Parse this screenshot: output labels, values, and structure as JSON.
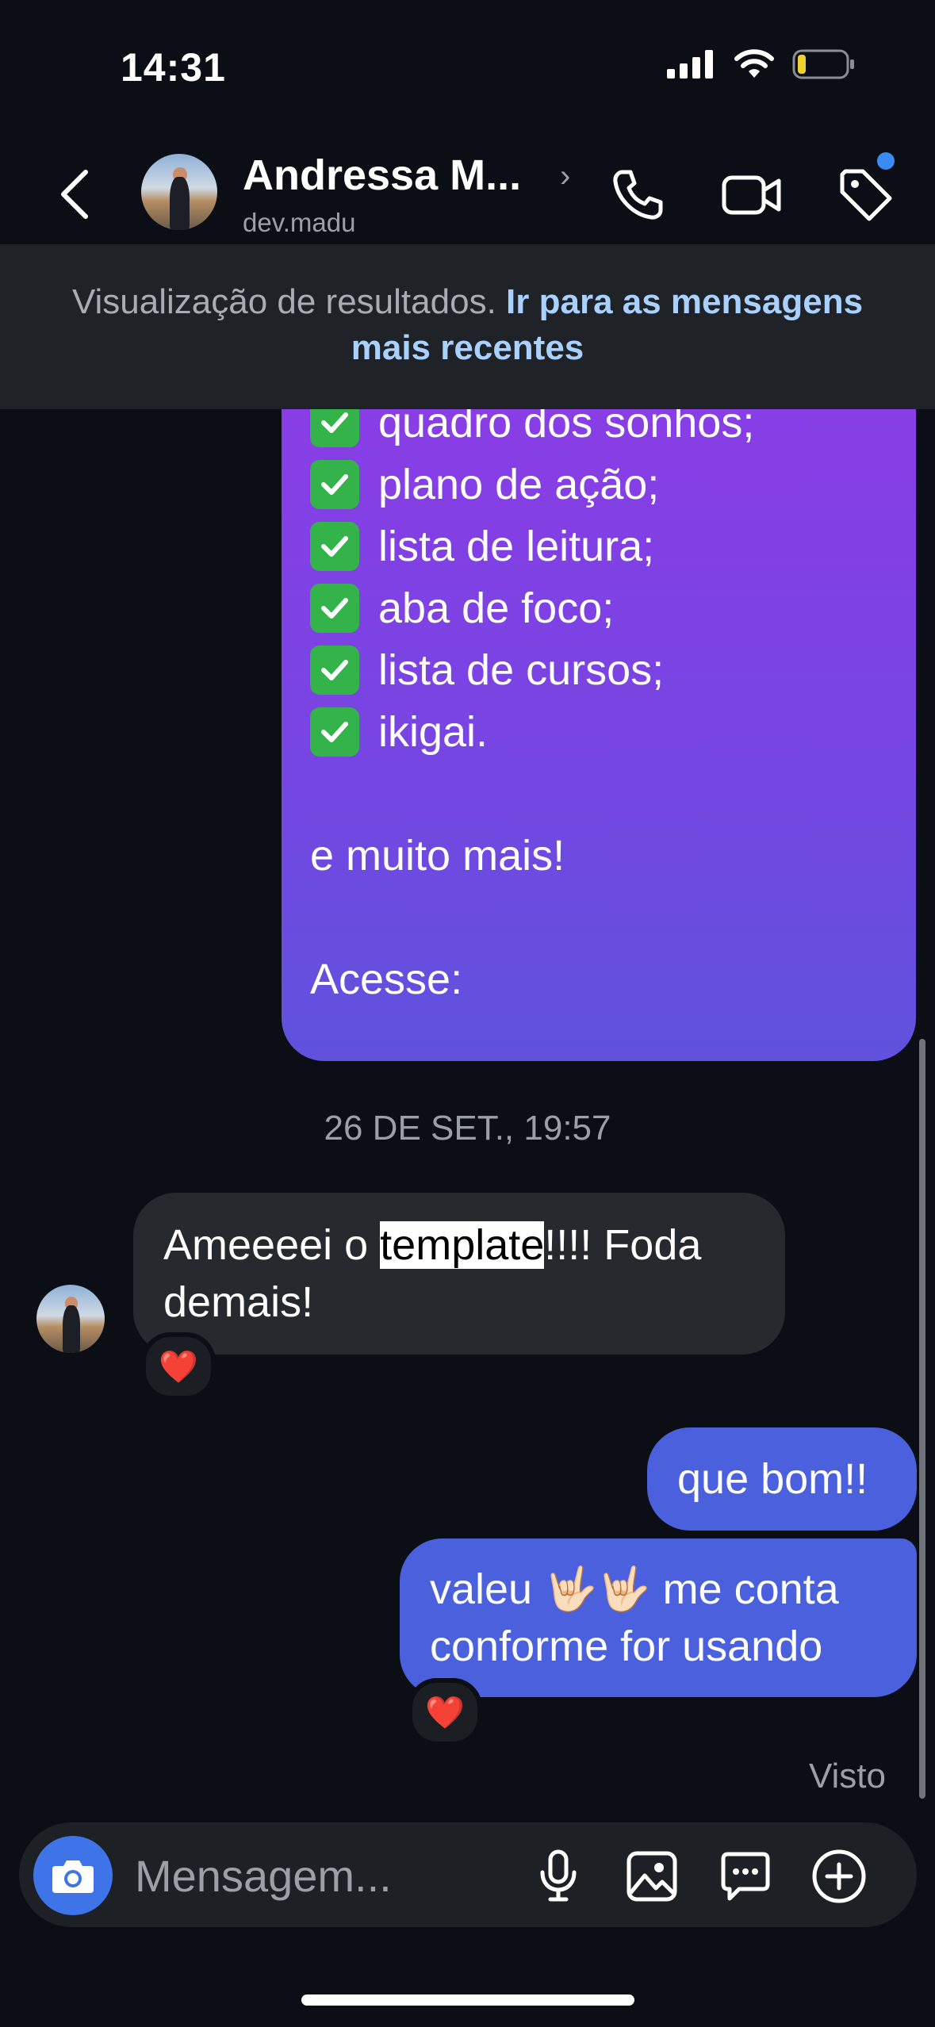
{
  "status_bar": {
    "time": "14:31"
  },
  "header": {
    "contact_name": "Andressa M...",
    "contact_handle": "dev.madu"
  },
  "banner": {
    "text": "Visualização de resultados.",
    "link": "Ir para as mensagens mais recentes"
  },
  "messages": {
    "sent_template_lines": [
      "quadro dos sonhos;",
      "plano de ação;",
      "lista de leitura;",
      "aba de foco;",
      "lista de cursos;",
      "ikigai."
    ],
    "sent_template_more": "e muito mais!",
    "sent_template_access": "Acesse:",
    "timestamp": "26 DE SET., 19:57",
    "received": {
      "before": "Ameeeei o ",
      "highlight": "template",
      "after": "!!!! Foda demais!",
      "reaction": "❤️"
    },
    "sent_reply_1": "que bom!!",
    "sent_reply_2": "valeu 🤟🏻🤟🏻 me conta conforme for usando",
    "sent_reply_2_reaction": "❤️",
    "seen_label": "Visto"
  },
  "composer": {
    "placeholder": "Mensagem..."
  },
  "colors": {
    "background": "#0b0f15",
    "sent_bubble": "#4a60dd",
    "received_bubble": "#26292e",
    "camera_button": "#3f74e8",
    "link": "#a8d1ff"
  }
}
